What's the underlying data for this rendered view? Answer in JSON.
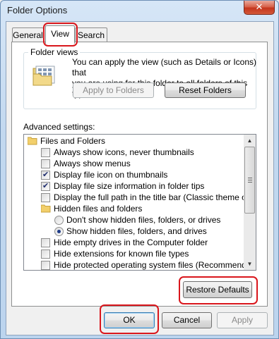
{
  "window": {
    "title": "Folder Options",
    "close_glyph": "✕"
  },
  "tabs": [
    {
      "label": "General"
    },
    {
      "label": "View"
    },
    {
      "label": "Search"
    }
  ],
  "folder_views": {
    "legend": "Folder views",
    "line1": "You can apply the view (such as Details or Icons) that",
    "line2": "you are using for this folder to all folders of this type.",
    "apply_label": "Apply to Folders",
    "reset_label": "Reset Folders"
  },
  "advanced": {
    "label": "Advanced settings:",
    "items": [
      {
        "type": "folder",
        "label": "Files and Folders"
      },
      {
        "type": "checkbox",
        "checked": false,
        "label": "Always show icons, never thumbnails"
      },
      {
        "type": "checkbox",
        "checked": false,
        "label": "Always show menus"
      },
      {
        "type": "checkbox",
        "checked": true,
        "label": "Display file icon on thumbnails"
      },
      {
        "type": "checkbox",
        "checked": true,
        "label": "Display file size information in folder tips"
      },
      {
        "type": "checkbox",
        "checked": false,
        "label": "Display the full path in the title bar (Classic theme only)"
      },
      {
        "type": "folder",
        "label": "Hidden files and folders"
      },
      {
        "type": "radio",
        "checked": false,
        "label": "Don't show hidden files, folders, or drives"
      },
      {
        "type": "radio",
        "checked": true,
        "label": "Show hidden files, folders, and drives"
      },
      {
        "type": "checkbox",
        "checked": false,
        "label": "Hide empty drives in the Computer folder"
      },
      {
        "type": "checkbox",
        "checked": false,
        "label": "Hide extensions for known file types"
      },
      {
        "type": "checkbox",
        "checked": false,
        "label": "Hide protected operating system files (Recommended)"
      }
    ],
    "check_glyph": "✔"
  },
  "buttons": {
    "restore_defaults": "Restore Defaults",
    "ok": "OK",
    "cancel": "Cancel",
    "apply": "Apply"
  },
  "colors": {
    "highlight": "#d9161c",
    "close_button": "#c5361d"
  }
}
